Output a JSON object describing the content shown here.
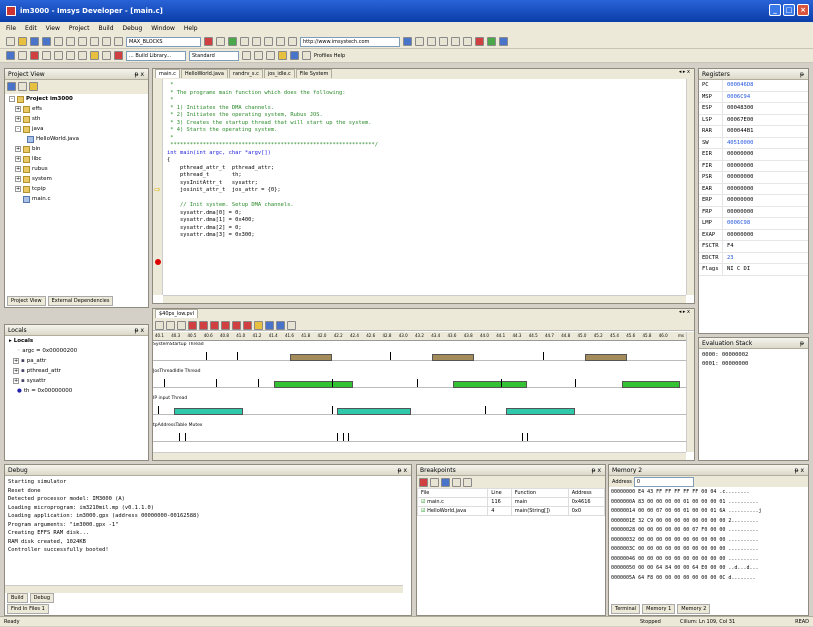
{
  "window": {
    "title": "im3000 - Imsys Developer - [main.c]"
  },
  "menu": [
    "File",
    "Edit",
    "View",
    "Project",
    "Build",
    "Debug",
    "Window",
    "Help"
  ],
  "toolbar": {
    "combo_blocks": "MAX_BLOCKS",
    "combo_url": "http://www.imsystech.com",
    "combo_build": "... Build Library...",
    "combo_standard": "Standard",
    "profiles_help": "Profiles Help"
  },
  "project_view": {
    "title": "Project View",
    "root": "Project im3000",
    "items": [
      "effs",
      "sth",
      "java",
      "HelloWorld.java",
      "bin",
      "libc",
      "rubus",
      "system",
      "tcpip",
      "main.c"
    ],
    "tabs": [
      "Project View",
      "External Dependencies"
    ]
  },
  "editor": {
    "tabs": [
      "main.c",
      "HelloWorld.java",
      "randrv_s.c",
      "jos_idle.c",
      "File System"
    ],
    "lines": [
      " *",
      " * The programs main function which does the following:",
      " *",
      " * 1) Initiates the DMA channels.",
      " * 2) Initiates the operating system, Rubus JOS.",
      " * 3) Creates the startup thread that will start up the system.",
      " * 4) Starts the operating system.",
      " *",
      " ***************************************************************/",
      "int main(int argc, char *argv[])",
      "{",
      "    pthread_attr_t  pthread_attr;",
      "    pthread_t       th;",
      "    sysInitAttr_t   sysattr;",
      "    josinit_attr_t  jos_attr = {0};",
      "",
      "    // Init system. Setup DMA channels.",
      "    sysattr.dma[0] = 0;",
      "    sysattr.dma[1] = 0x400;",
      "    sysattr.dma[2] = 0;",
      "    sysattr.dma[3] = 0x300;"
    ]
  },
  "registers": {
    "title": "Registers",
    "rows": [
      {
        "name": "PC",
        "value": "000046D8",
        "hl": true
      },
      {
        "name": "MSP",
        "value": "0006C94",
        "hl": true
      },
      {
        "name": "ESP",
        "value": "00048300",
        "hl": false
      },
      {
        "name": "LSP",
        "value": "00067E00",
        "hl": false
      },
      {
        "name": "RAR",
        "value": "000044B1",
        "hl": false
      },
      {
        "name": "SW",
        "value": "40510000",
        "hl": true
      },
      {
        "name": "EIR",
        "value": "00000000",
        "hl": false
      },
      {
        "name": "FIR",
        "value": "00000000",
        "hl": false
      },
      {
        "name": "PSR",
        "value": "00000000",
        "hl": false
      },
      {
        "name": "EAR",
        "value": "00000000",
        "hl": false
      },
      {
        "name": "ERP",
        "value": "00000000",
        "hl": false
      },
      {
        "name": "FRP",
        "value": "00000000",
        "hl": false
      },
      {
        "name": "LMP",
        "value": "0006C98",
        "hl": true
      },
      {
        "name": "EXAP",
        "value": "00000000",
        "hl": false
      },
      {
        "name": "FSCTR",
        "value": "F4",
        "hl": false
      },
      {
        "name": "EDCTR",
        "value": "23",
        "hl": true
      },
      {
        "name": "Flags",
        "value": "NI C DI",
        "hl": false
      }
    ]
  },
  "timeline": {
    "file_tab": "$40ps_low.pvl",
    "ticks": [
      "40.1",
      "40.3",
      "40.5",
      "40.6",
      "40.8",
      "41.0",
      "41.2",
      "41.4",
      "41.6",
      "41.8",
      "42.0",
      "42.2",
      "42.4",
      "42.6",
      "42.8",
      "43.0",
      "43.2",
      "43.4",
      "43.6",
      "43.8",
      "44.0",
      "44.1",
      "44.3",
      "44.5",
      "44.7",
      "44.8",
      "45.0",
      "45.2",
      "45.4",
      "45.6",
      "45.8",
      "46.0"
    ],
    "unit": "ms",
    "threads": [
      {
        "name": "SystemStartup Thread",
        "color": "#a38b5b",
        "bars": [
          [
            0.26,
            0.34
          ],
          [
            0.53,
            0.61
          ],
          [
            0.82,
            0.9
          ]
        ],
        "ticks": [
          0.1,
          0.16,
          0.45,
          0.74
        ]
      },
      {
        "name": "JosThreadIdle Thread",
        "color": "#33c233",
        "bars": [
          [
            0.23,
            0.38
          ],
          [
            0.57,
            0.71
          ],
          [
            0.89,
            1.0
          ]
        ],
        "ticks": [
          0.02,
          0.12,
          0.2,
          0.34,
          0.5,
          0.66,
          0.8
        ]
      },
      {
        "name": "IP input Thread",
        "color": "#30c8aa",
        "bars": [
          [
            0.04,
            0.17
          ],
          [
            0.35,
            0.49
          ],
          [
            0.67,
            0.8
          ]
        ],
        "ticks": [
          0.01,
          0.34,
          0.63
        ]
      },
      {
        "name": "tpAddressTable Mutex",
        "color": "#888",
        "bars": [],
        "ticks": [
          0.05,
          0.06,
          0.35,
          0.36,
          0.37,
          0.7,
          0.71
        ]
      }
    ]
  },
  "locals": {
    "title": "Locals",
    "root": "Locals",
    "items": [
      "argc = 0x00000200",
      "pa_attr",
      "pthread_attr",
      "sysattr",
      "th = 0x00000000"
    ]
  },
  "eval_stack": {
    "title": "Evaluation Stack",
    "rows": [
      "0000: 00000002",
      "0001: 00000000"
    ]
  },
  "debug": {
    "title": "Debug",
    "lines": [
      "Starting simulator",
      "Reset done",
      "Detected processor model: IM3000 (A)",
      "Loading microprogram: im3210mil.mp (v0.1.1.0)",
      "Loading application: im3000.gpx (address 00000000-00162588)",
      "Program arguments: \"im3000.gpx -1\"",
      "Creating EFFS RAM disk...",
      "RAM disk created, 1024KB",
      "Controller successfully booted!"
    ],
    "tabs": [
      "Build",
      "Debug"
    ],
    "find_tab": "Find In Files 1"
  },
  "breakpoints": {
    "title": "Breakpoints",
    "headers": [
      "File",
      "Line",
      "Function",
      "Address"
    ],
    "rows": [
      [
        "main.c",
        "116",
        "main",
        "0x4616"
      ],
      [
        "HelloWorld.java",
        "4",
        "main(String[])",
        "0x0"
      ]
    ]
  },
  "memory": {
    "title": "Memory 2",
    "address_label": "Address",
    "address_value": "0",
    "rows": [
      [
        "00000000",
        "E4 43 FF FF FF FF FF 00 04",
        ".c........"
      ],
      [
        "0000000A",
        "83 00 00 00 00 01 00 00 00 01",
        ".........."
      ],
      [
        "00000014",
        "00 00 07 00 00 01 00 00 01 6A",
        "..........j"
      ],
      [
        "0000001E",
        "32 C9 00 00 00 00 00 00 00 00",
        "2........."
      ],
      [
        "00000028",
        "00 00 00 00 00 00 07 F0 00 00",
        ".........."
      ],
      [
        "00000032",
        "00 00 00 00 00 00 00 00 00 00",
        ".........."
      ],
      [
        "0000003C",
        "00 00 00 00 00 00 00 00 00 00",
        ".........."
      ],
      [
        "00000046",
        "00 00 00 00 00 00 00 00 00 00",
        ".........."
      ],
      [
        "00000050",
        "00 00 64 84 00 00 64 E0 00 00",
        "..d...d..."
      ],
      [
        "0000005A",
        "64 F8 00 00 00 00 00 00 00 0C",
        "d........"
      ]
    ],
    "tabs": [
      "Terminal",
      "Memory 1",
      "Memory 2"
    ]
  },
  "status": {
    "left": "Ready",
    "mid": "Stopped",
    "pos": "Cilium: Ln 109, Col 31",
    "mode": "READ"
  }
}
